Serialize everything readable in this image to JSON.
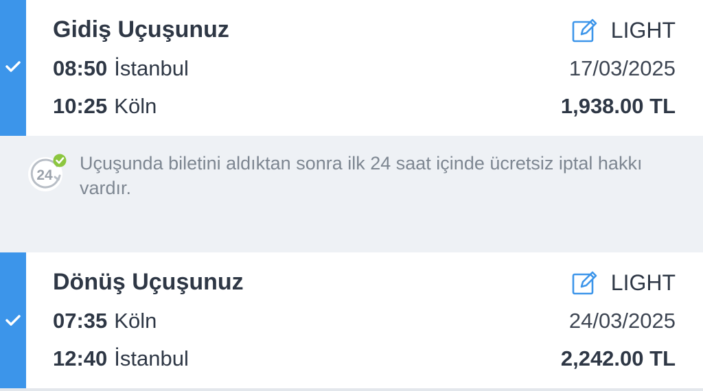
{
  "outbound": {
    "title": "Gidiş Uçuşunuz",
    "fare_label": "LIGHT",
    "departure_time": "08:50",
    "departure_city": "İstanbul",
    "arrival_time": "10:25",
    "arrival_city": "Köln",
    "date": "17/03/2025",
    "price": "1,938.00 TL"
  },
  "notice": {
    "icon_text": "24",
    "text": "Uçuşunda biletini aldıktan sonra ilk 24 saat içinde ücretsiz iptal hakkı vardır."
  },
  "return": {
    "title": "Dönüş Uçuşunuz",
    "fare_label": "LIGHT",
    "departure_time": "07:35",
    "departure_city": "Köln",
    "arrival_time": "12:40",
    "arrival_city": "İstanbul",
    "date": "24/03/2025",
    "price": "2,242.00 TL"
  },
  "colors": {
    "accent": "#3c95ea",
    "notice_background": "#eef1f5",
    "check_badge": "#8cc63f",
    "text_primary": "#2e3745",
    "text_muted": "#7d8691"
  },
  "icons": {
    "selected": "check-icon",
    "fare": "edit-icon",
    "notice": "24-hour-cancel-icon"
  }
}
